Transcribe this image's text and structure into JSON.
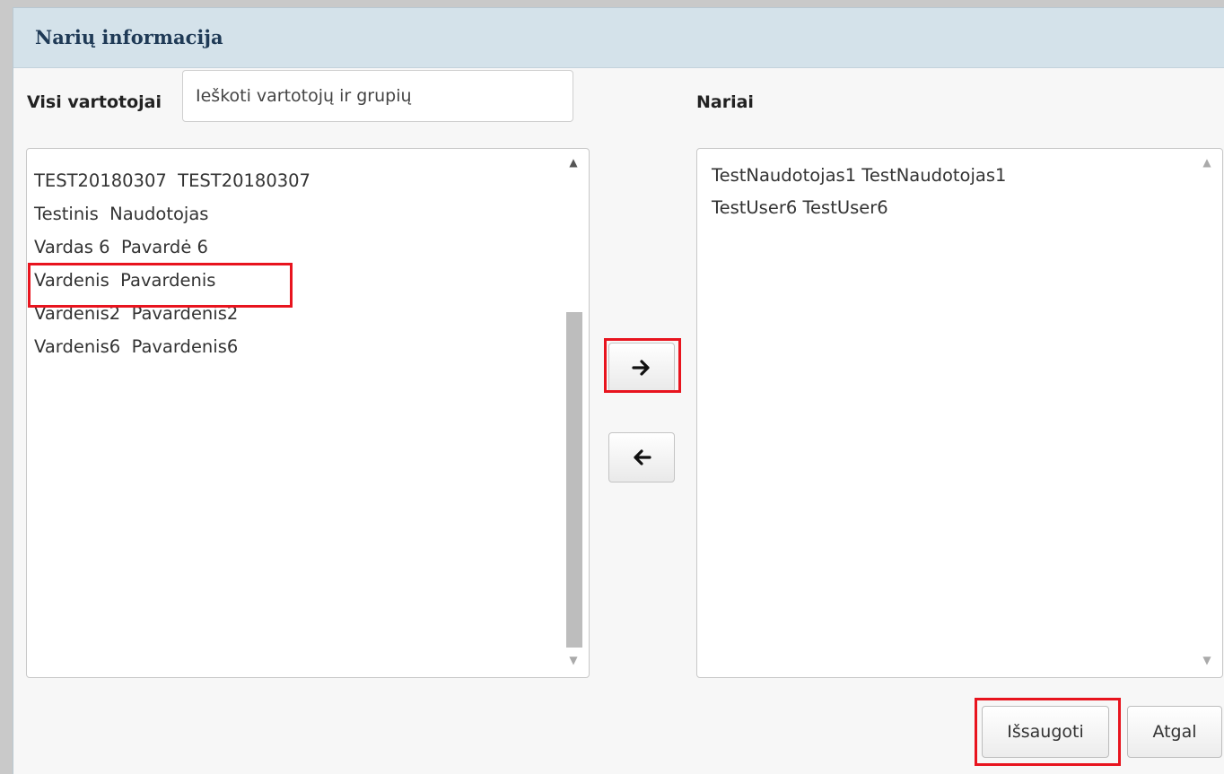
{
  "dialog": {
    "title": "Narių informacija"
  },
  "left": {
    "label": "Visi vartotojai",
    "search_placeholder": "Ieškoti vartotojų ir grupių",
    "items": [
      {
        "label": "TEST20180307  TEST20180307"
      },
      {
        "label": "Testinis  Naudotojas"
      },
      {
        "label": "Vardas 6  Pavardė 6"
      },
      {
        "label": "Vardenis  Pavardenis"
      },
      {
        "label": "Vardenis2  Pavardenis2"
      },
      {
        "label": "Vardenis6  Pavardenis6"
      }
    ]
  },
  "right": {
    "label": "Nariai",
    "items": [
      {
        "label": "TestNaudotojas1 TestNaudotojas1"
      },
      {
        "label": "TestUser6 TestUser6"
      }
    ]
  },
  "buttons": {
    "save": "Išsaugoti",
    "back": "Atgal",
    "move_right_icon": "arrow-right-icon",
    "move_left_icon": "arrow-left-icon"
  },
  "annotations": {
    "highlight_color": "#e8141e"
  }
}
